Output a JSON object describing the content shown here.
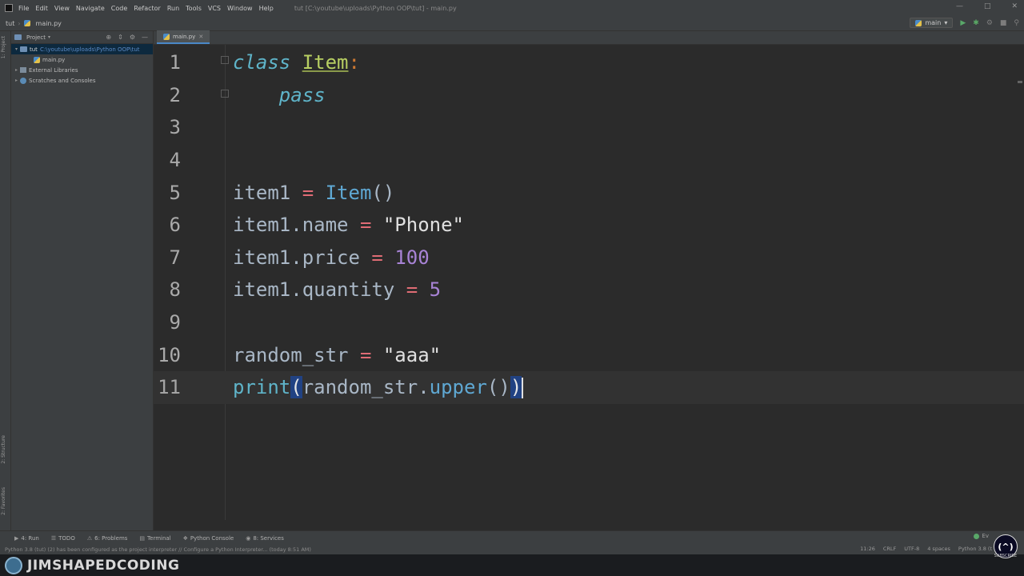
{
  "window": {
    "title": "tut [C:\\youtube\\uploads\\Python OOP\\tut] - main.py",
    "menu": [
      "File",
      "Edit",
      "View",
      "Navigate",
      "Code",
      "Refactor",
      "Run",
      "Tools",
      "VCS",
      "Window",
      "Help"
    ]
  },
  "navbar": {
    "breadcrumb": [
      "tut",
      "main.py"
    ],
    "run_config": "main"
  },
  "left_strip": {
    "project_label": "1: Project",
    "structure_label": "2: Structure",
    "favorites_label": "2: Favorites"
  },
  "project_panel": {
    "title": "Project",
    "tree": [
      {
        "label": "tut",
        "path": "C:\\youtube\\uploads\\Python OOP\\tut",
        "type": "folder"
      },
      {
        "label": "main.py",
        "type": "file"
      },
      {
        "label": "External Libraries",
        "type": "library"
      },
      {
        "label": "Scratches and Consoles",
        "type": "scratch"
      }
    ]
  },
  "editor": {
    "tab_label": "main.py",
    "current_line": 11,
    "line_numbers": [
      "1",
      "2",
      "3",
      "4",
      "5",
      "6",
      "7",
      "8",
      "9",
      "10",
      "11"
    ],
    "code": {
      "l1_kw": "class",
      "l1_name": "Item",
      "l1_colon": ":",
      "l2_kw": "pass",
      "l5_var": "item1",
      "l5_op": "=",
      "l5_call": "Item",
      "l5_paren": "()",
      "l6_var": "item1.name",
      "l6_op": "=",
      "l6_val": "\"Phone\"",
      "l7_var": "item1.price",
      "l7_op": "=",
      "l7_val": "100",
      "l8_var": "item1.quantity",
      "l8_op": "=",
      "l8_val": "5",
      "l10_var": "random_str",
      "l10_op": "=",
      "l10_val": "\"aaa\"",
      "l11_fn": "print",
      "l11_open": "(",
      "l11_obj": "random_str.",
      "l11_method": "upper",
      "l11_args": "()",
      "l11_close": ")"
    }
  },
  "tool_windows": [
    {
      "icon": "run-icon",
      "label": "4: Run"
    },
    {
      "icon": "todo-icon",
      "label": "TODO"
    },
    {
      "icon": "problems-icon",
      "label": "6: Problems"
    },
    {
      "icon": "terminal-icon",
      "label": "Terminal"
    },
    {
      "icon": "python-console-icon",
      "label": "Python Console"
    },
    {
      "icon": "services-icon",
      "label": "8: Services"
    }
  ],
  "event_log": "Ev",
  "statusbar": {
    "message": "Python 3.8 (tut) (2) has been configured as the project interpreter // Configure a Python Interpreter... (today 8:51 AM)",
    "position": "11:26",
    "line_sep": "CRLF",
    "encoding": "UTF-8",
    "indent": "4 spaces",
    "interpreter": "Python 3.8 (t"
  },
  "watermark": {
    "text": "JIMSHAPEDCODING",
    "badge": "(^)",
    "badge_sub": "SUBSCRIBE"
  },
  "colors": {
    "keyword": "#5fb4c9",
    "class_name": "#b8cf62",
    "operator": "#e06c75",
    "number": "#a883d6",
    "string": "#e0e0e0",
    "selection": "#214283"
  }
}
